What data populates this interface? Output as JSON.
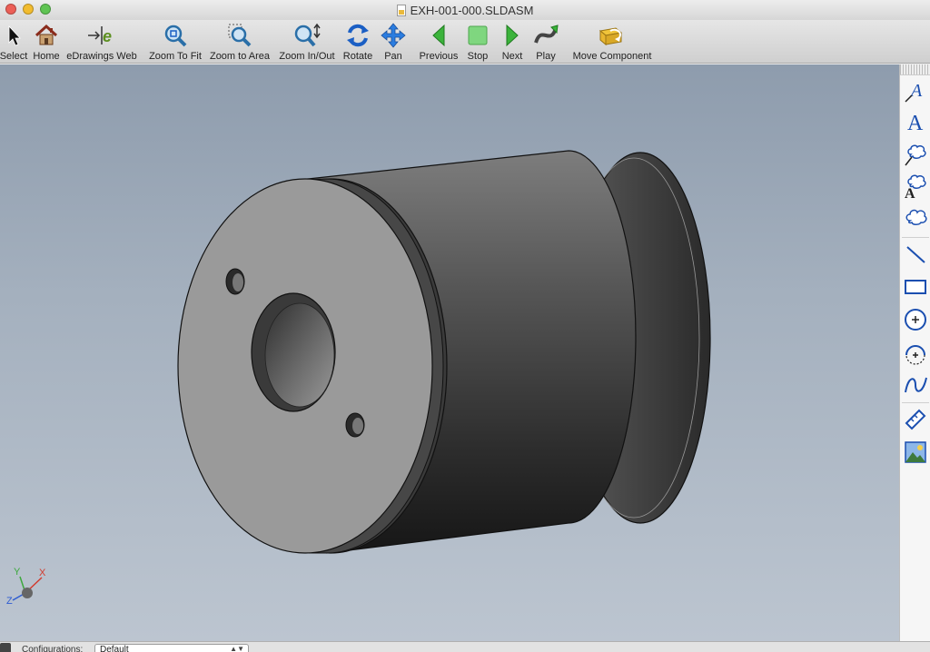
{
  "window": {
    "title": "EXH-001-000.SLDASM"
  },
  "toolbar": {
    "items": [
      {
        "label": "Select",
        "icon": "arrow-pointer-icon"
      },
      {
        "label": "Home",
        "icon": "home-icon"
      },
      {
        "label": "eDrawings Web",
        "icon": "edrawings-web-icon"
      },
      {
        "label": "Zoom To Fit",
        "icon": "zoom-to-fit-icon"
      },
      {
        "label": "Zoom to Area",
        "icon": "zoom-to-area-icon"
      },
      {
        "label": "Zoom In/Out",
        "icon": "zoom-in-out-icon"
      },
      {
        "label": "Rotate",
        "icon": "rotate-icon"
      },
      {
        "label": "Pan",
        "icon": "pan-icon"
      },
      {
        "label": "Previous",
        "icon": "previous-icon"
      },
      {
        "label": "Stop",
        "icon": "stop-icon"
      },
      {
        "label": "Next",
        "icon": "next-icon"
      },
      {
        "label": "Play",
        "icon": "play-icon"
      },
      {
        "label": "Move Component",
        "icon": "move-component-icon"
      }
    ]
  },
  "triad": {
    "x": "X",
    "y": "Y",
    "z": "Z"
  },
  "markup": {
    "tools": [
      "text-note-icon",
      "text-icon",
      "cloud-leader-icon",
      "cloud-text-icon",
      "cloud-icon",
      "line-icon",
      "rectangle-icon",
      "circle-icon",
      "arc-icon",
      "spline-icon",
      "dimension-icon",
      "image-icon"
    ]
  },
  "status": {
    "config_label": "Configurations:",
    "config_value": "Default"
  },
  "colors": {
    "accent_blue": "#1b5fc4",
    "play_green": "#2f9e2f",
    "viewport_top": "#8e9cad",
    "viewport_bottom": "#bcc5d0"
  }
}
